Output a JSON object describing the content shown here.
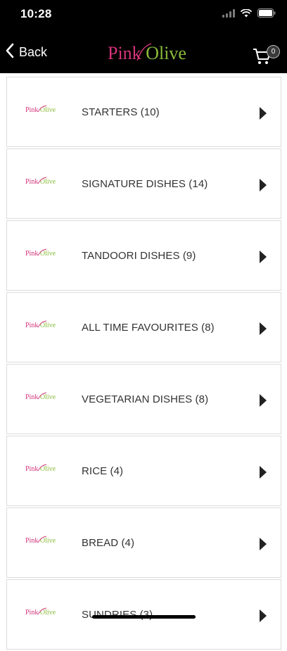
{
  "status_bar": {
    "time": "10:28"
  },
  "nav": {
    "back_label": "Back",
    "logo_pink": "Pink",
    "logo_olive": "Olive",
    "cart_count": "0",
    "back_icon": "chevron-left-icon",
    "cart_icon": "shopping-cart-icon"
  },
  "colors": {
    "header_bg": "#000000",
    "logo_pink": "#d6347a",
    "logo_olive": "#8bbb3a",
    "row_text": "#333333",
    "row_border": "#dcdcdc"
  },
  "row_logo": {
    "pink": "Pink",
    "olive": "Olive"
  },
  "categories": [
    {
      "label": "STARTERS  (10)"
    },
    {
      "label": "SIGNATURE DISHES  (14)"
    },
    {
      "label": "TANDOORI DISHES  (9)"
    },
    {
      "label": "ALL TIME FAVOURITES  (8)"
    },
    {
      "label": "VEGETARIAN DISHES  (8)"
    },
    {
      "label": "RICE  (4)"
    },
    {
      "label": "BREAD  (4)"
    },
    {
      "label": "SUNDRIES  (3)"
    }
  ]
}
